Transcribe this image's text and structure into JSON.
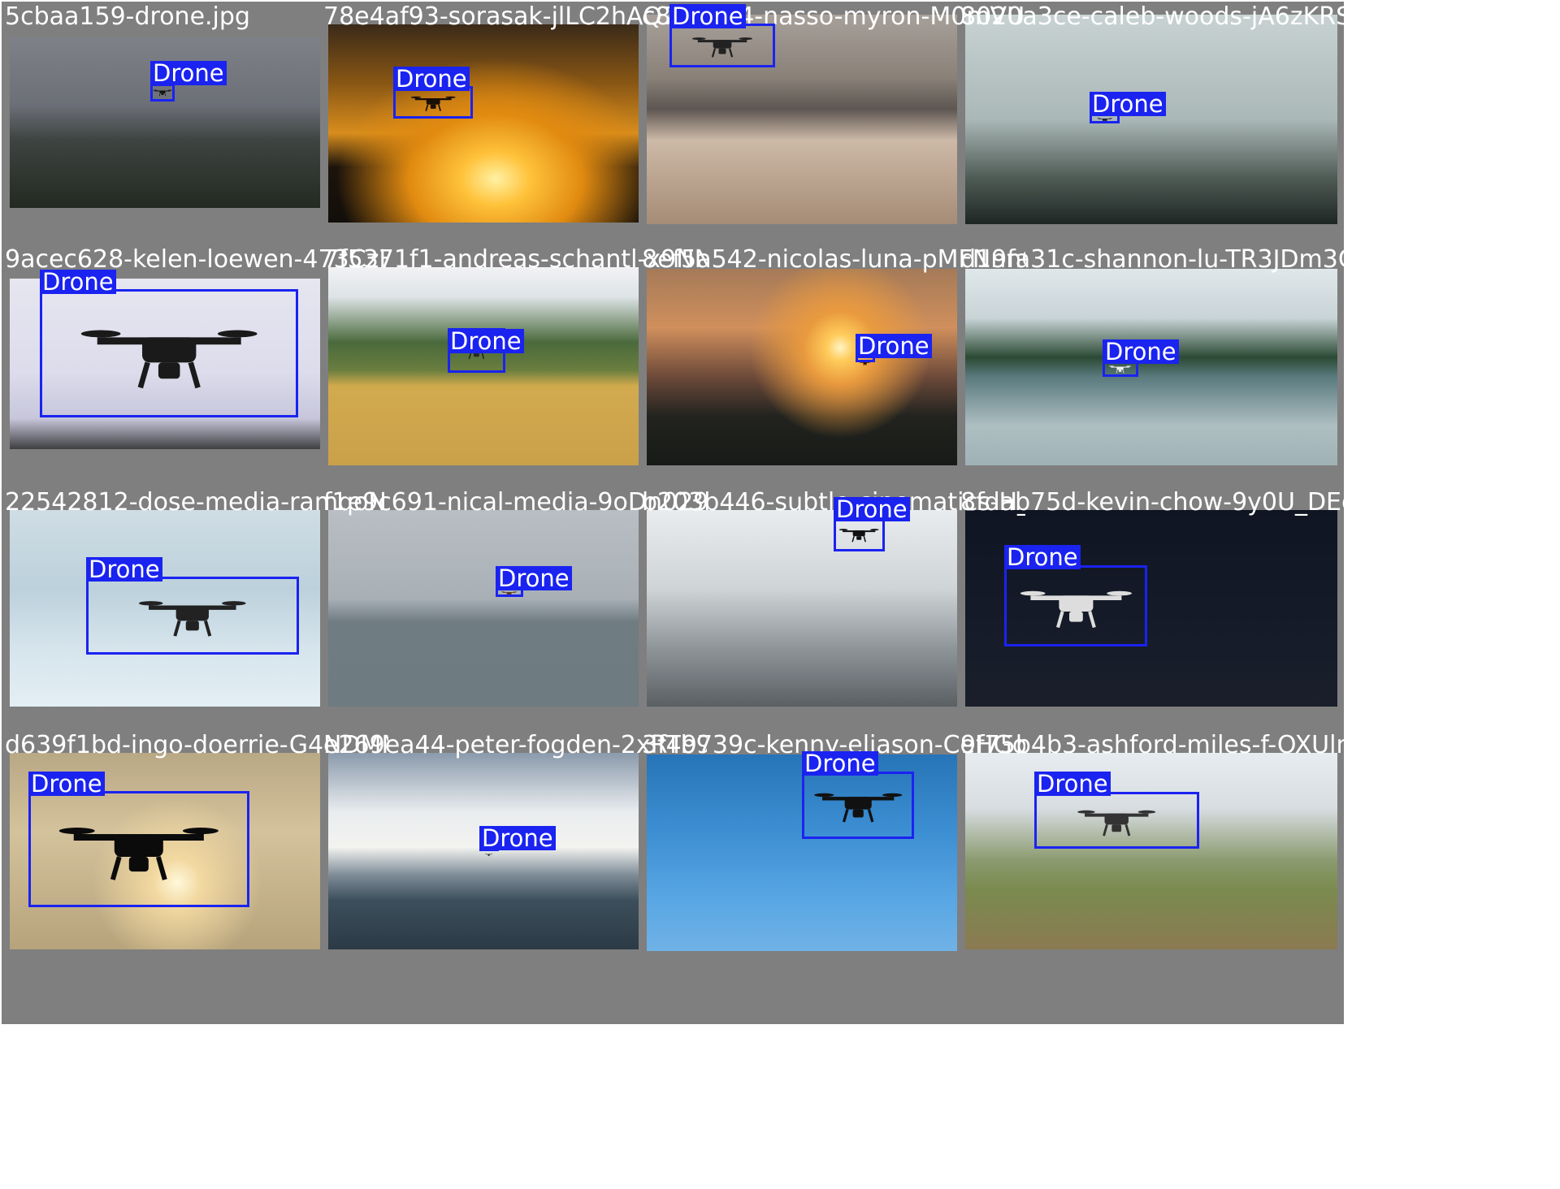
{
  "detection_class": "Drone",
  "box_color": "#1a23f0",
  "tiles": [
    {
      "filename": "5cbaa159-drone.jpg"
    },
    {
      "filename": "78e4af93-sorasak-jlLC2hAQ7uQ-unsplash"
    },
    {
      "filename": "c8f9c2a4-nasso-myron-M0mVUM6896A-unsplash"
    },
    {
      "filename": "8020a3ce-caleb-woods-jA6zKRSYx3I-unsplash"
    },
    {
      "filename": "9acec628-kelen-loewen-473CzHmE3WE-unsplash"
    },
    {
      "filename": "7f5371f1-andreas-schantl-x9NNCXEa54A-unsplash"
    },
    {
      "filename": "8ef5a542-nicolas-luna-pMFNnnCE16A-unsplash"
    },
    {
      "filename": "d19fa31c-shannon-lu-TR3JDm3CRpw-unsplash"
    },
    {
      "filename": "22542812-dose-media-ramqoN2KhuI-unsplash"
    },
    {
      "filename": "f1e9c691-nical-media-9oDn029-2Q8-unsplash"
    },
    {
      "filename": "b203b446-subtle-cinematics-H_3bl_6P25Y-unsplash"
    },
    {
      "filename": "8fdab75d-kevin-chow-9y0U_DEgZ0E-unsplash"
    },
    {
      "filename": "d639f1bd-ingo-doerrie-G4NDMMe2699-unsplash"
    },
    {
      "filename": "e269ea44-peter-fogden-2xRTb9V84N8-unsplash"
    },
    {
      "filename": "3f49739c-kenny-eliason-CeHGoP1Zbh0-unsplash"
    },
    {
      "filename": "9f75b4b3-ashford-miles-f-OXUlmTZj4-unsplash"
    }
  ]
}
